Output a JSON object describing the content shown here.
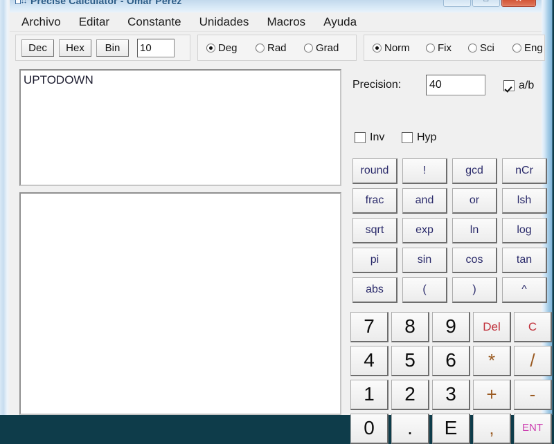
{
  "window": {
    "title": "Precise Calculator - Omar Pérez",
    "icon": "calculator-icon",
    "controls": {
      "minimize": "—",
      "maximize": "□",
      "close": "✕"
    }
  },
  "menu": {
    "items": [
      {
        "label": "Archivo"
      },
      {
        "label": "Editar"
      },
      {
        "label": "Constante"
      },
      {
        "label": "Unidades"
      },
      {
        "label": "Macros"
      },
      {
        "label": "Ayuda"
      }
    ]
  },
  "toolbar": {
    "base_buttons": [
      {
        "label": "Dec"
      },
      {
        "label": "Hex"
      },
      {
        "label": "Bin"
      }
    ],
    "base_value": "10",
    "angle_modes": [
      {
        "label": "Deg",
        "selected": true
      },
      {
        "label": "Rad",
        "selected": false
      },
      {
        "label": "Grad",
        "selected": false
      }
    ],
    "notation_modes": [
      {
        "label": "Norm",
        "selected": true
      },
      {
        "label": "Fix",
        "selected": false
      },
      {
        "label": "Sci",
        "selected": false
      },
      {
        "label": "Eng",
        "selected": false
      }
    ]
  },
  "display": {
    "input_text": "UPTODOWN",
    "output_text": ""
  },
  "options": {
    "precision_label": "Precision:",
    "precision_value": "40",
    "ab_label": "a/b",
    "ab_checked": true,
    "inv_label": "Inv",
    "inv_checked": false,
    "hyp_label": "Hyp",
    "hyp_checked": false
  },
  "function_keys": [
    "round",
    "!",
    "gcd",
    "nCr",
    "frac",
    "and",
    "or",
    "lsh",
    "sqrt",
    "exp",
    "ln",
    "log",
    "pi",
    "sin",
    "cos",
    "tan",
    "abs",
    "(",
    ")",
    "^"
  ],
  "numeric_keys": [
    {
      "label": "7",
      "style": "digit"
    },
    {
      "label": "8",
      "style": "digit"
    },
    {
      "label": "9",
      "style": "digit"
    },
    {
      "label": "Del",
      "style": "red"
    },
    {
      "label": "C",
      "style": "red"
    },
    {
      "label": "4",
      "style": "digit"
    },
    {
      "label": "5",
      "style": "digit"
    },
    {
      "label": "6",
      "style": "digit"
    },
    {
      "label": "*",
      "style": "op"
    },
    {
      "label": "/",
      "style": "op"
    },
    {
      "label": "1",
      "style": "digit"
    },
    {
      "label": "2",
      "style": "digit"
    },
    {
      "label": "3",
      "style": "digit"
    },
    {
      "label": "+",
      "style": "op"
    },
    {
      "label": "-",
      "style": "op"
    },
    {
      "label": "0",
      "style": "digit"
    },
    {
      "label": ".",
      "style": "digit"
    },
    {
      "label": "E",
      "style": "digit"
    },
    {
      "label": ",",
      "style": "op"
    },
    {
      "label": "ENT",
      "style": "magenta"
    }
  ],
  "colors": {
    "frame": "#c6dcef",
    "client_bg": "#f0f0f0",
    "title_text": "#2a5b86",
    "key_text": "#2a2a6a",
    "red_key": "#c0303a",
    "op_key": "#9a5a21",
    "magenta_key": "#cc3fb0",
    "close_button": "#cf4a2c"
  }
}
